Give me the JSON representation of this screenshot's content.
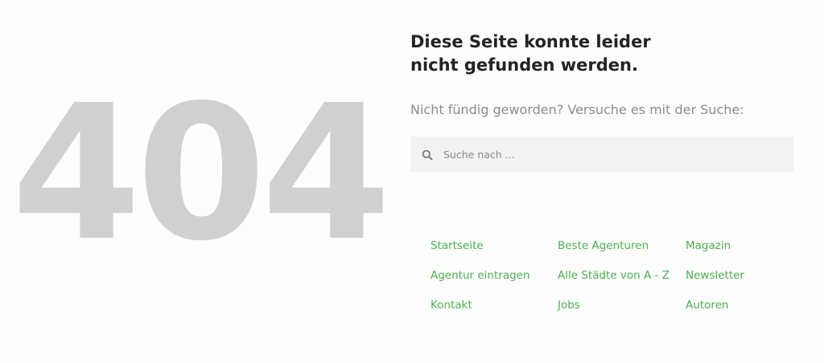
{
  "error": {
    "code": "404",
    "heading_line1": "Diese Seite konnte leider",
    "heading_line2": "nicht gefunden werden.",
    "subtext": "Nicht fündig geworden? Versuche es mit der Suche:"
  },
  "search": {
    "icon": "search-icon",
    "placeholder": "Suche nach ..."
  },
  "links": [
    {
      "label": "Startseite"
    },
    {
      "label": "Beste Agenturen"
    },
    {
      "label": "Magazin"
    },
    {
      "label": "Agentur eintragen"
    },
    {
      "label": "Alle Städte von A - Z"
    },
    {
      "label": "Newsletter"
    },
    {
      "label": "Kontakt"
    },
    {
      "label": "Jobs"
    },
    {
      "label": "Autoren"
    }
  ],
  "colors": {
    "code_gray": "#d0d0d0",
    "heading": "#232323",
    "subtext": "#8b8b8b",
    "search_bg": "#f2f2f2",
    "link_green": "#4caf50"
  }
}
